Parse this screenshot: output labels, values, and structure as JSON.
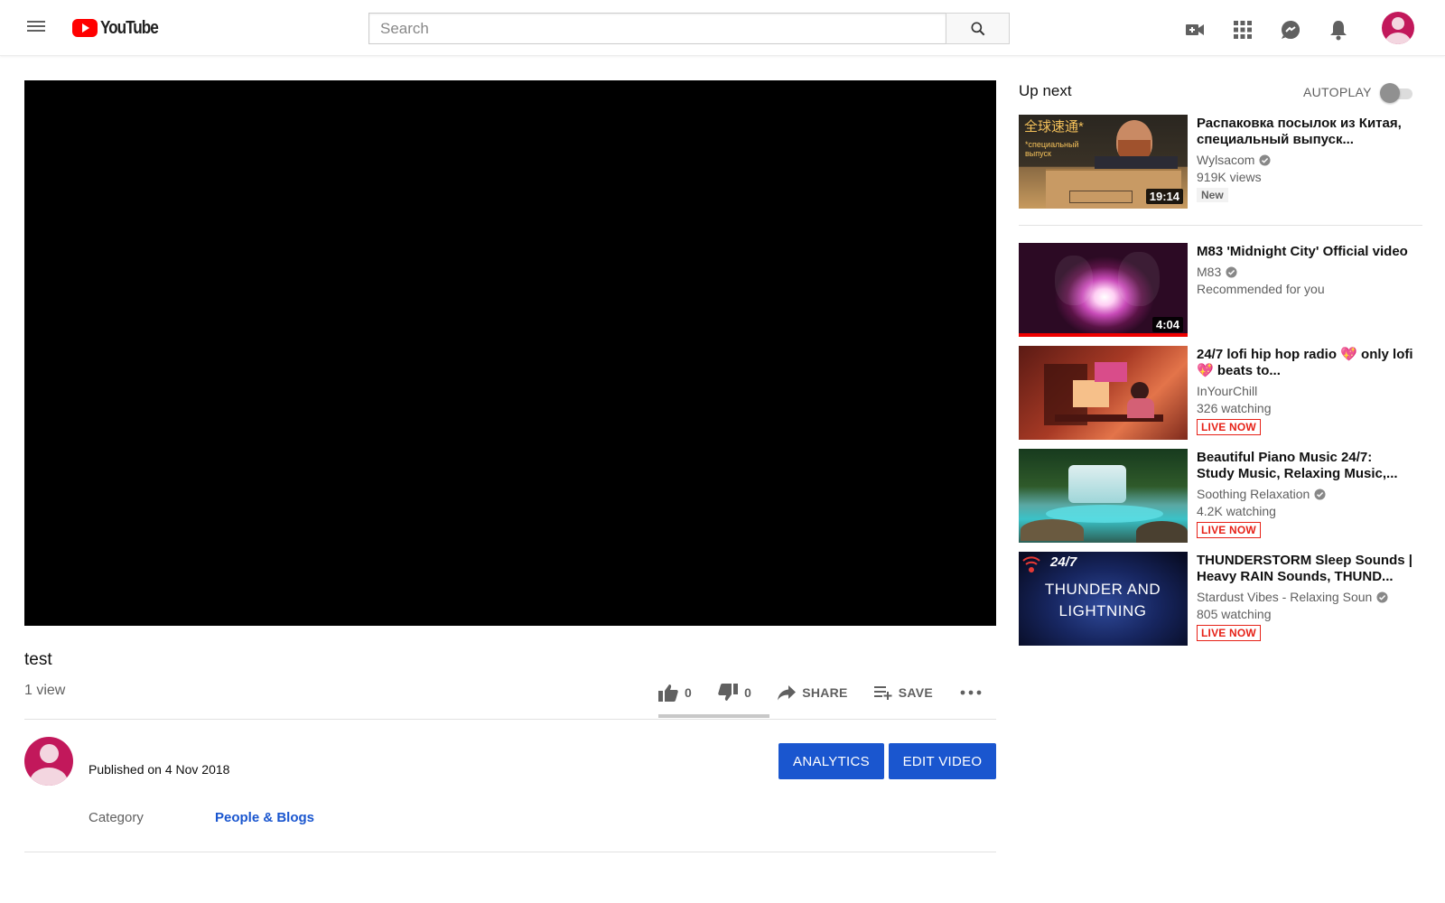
{
  "header": {
    "logo_text": "YouTube",
    "search_placeholder": "Search"
  },
  "video": {
    "title": "test",
    "views": "1 view",
    "likes": "0",
    "dislikes": "0",
    "share_label": "SHARE",
    "save_label": "SAVE",
    "like_ratio": 0.5
  },
  "owner": {
    "published": "Published on 4 Nov 2018",
    "analytics_label": "ANALYTICS",
    "edit_label": "EDIT VIDEO",
    "category_label": "Category",
    "category_value": "People & Blogs"
  },
  "sidebar": {
    "up_next": "Up next",
    "autoplay": "AUTOPLAY",
    "autoplay_on": false,
    "items": [
      {
        "title": "Распаковка посылок из Китая, специальный выпуск...",
        "channel": "Wylsacom",
        "verified": true,
        "sub": "919K views",
        "badge": "New",
        "duration": "19:14",
        "thumb_text_1": "全球速通*",
        "thumb_text_2": "*специальный выпуск"
      },
      {
        "title": "M83 'Midnight City' Official video",
        "channel": "M83",
        "verified": true,
        "sub": "Recommended for you",
        "duration": "4:04"
      },
      {
        "title": "24/7 lofi hip hop radio",
        "title_b": "only lofi",
        "title_c": "beats to...",
        "channel": "InYourChill",
        "sub": "326 watching",
        "badge": "LIVE NOW"
      },
      {
        "title": "Beautiful Piano Music 24/7: Study Music, Relaxing Music,...",
        "channel": "Soothing Relaxation",
        "verified": true,
        "sub": "4.2K watching",
        "badge": "LIVE NOW"
      },
      {
        "title": "THUNDERSTORM Sleep Sounds | Heavy RAIN Sounds, THUND...",
        "channel": "Stardust Vibes - Relaxing Soun",
        "verified": true,
        "sub": "805 watching",
        "badge": "LIVE NOW",
        "thumb_text_1": "24/7",
        "thumb_text_2": "THUNDER AND LIGHTNING"
      }
    ]
  },
  "colors": {
    "brand_red": "#ff0000",
    "link_blue": "#1a56cf",
    "live_red": "#e62117",
    "avatar": "#c2185b"
  },
  "icons": [
    "menu-icon",
    "search-icon",
    "create-video-icon",
    "apps-icon",
    "messages-icon",
    "notifications-icon",
    "like-icon",
    "dislike-icon",
    "share-icon",
    "save-icon",
    "more-icon",
    "verified-icon",
    "heart-emoji"
  ]
}
